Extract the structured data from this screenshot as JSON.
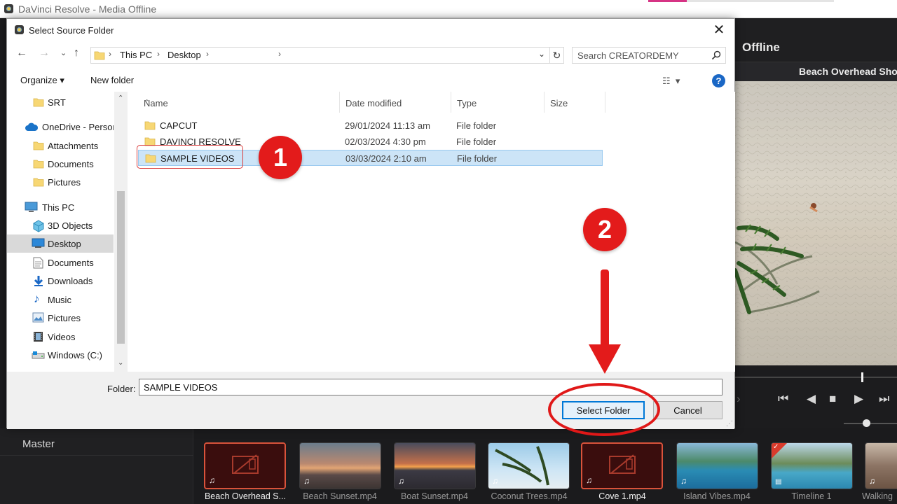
{
  "app": {
    "window_title": "DaVinci Resolve - Media Offline",
    "viewer_status": "Offline",
    "viewer_clip_name": "Beach Overhead Sho",
    "master_label": "Master",
    "clips": [
      {
        "name": "Beach Overhead S...",
        "offline": true,
        "active": true
      },
      {
        "name": "Beach Sunset.mp4",
        "offline": false,
        "active": false
      },
      {
        "name": "Boat Sunset.mp4",
        "offline": false,
        "active": false
      },
      {
        "name": "Coconut Trees.mp4",
        "offline": false,
        "active": false
      },
      {
        "name": "Cove 1.mp4",
        "offline": true,
        "active": true
      },
      {
        "name": "Island Vibes.mp4",
        "offline": false,
        "active": false
      },
      {
        "name": "Timeline 1",
        "offline": false,
        "active": false
      },
      {
        "name": "Walking",
        "offline": false,
        "active": false
      }
    ]
  },
  "dialog": {
    "title": "Select Source Folder",
    "address": {
      "crumbs": [
        "This PC",
        "Desktop"
      ]
    },
    "search_placeholder": "Search CREATORDEMY",
    "toolbar": {
      "organize": "Organize ▾",
      "new_folder": "New folder"
    },
    "nav_items": [
      {
        "label": "SRT",
        "icon": "folder-icon"
      },
      {
        "label": "OneDrive - Person",
        "icon": "cloud-icon"
      },
      {
        "label": "Attachments",
        "icon": "folder-icon"
      },
      {
        "label": "Documents",
        "icon": "folder-icon"
      },
      {
        "label": "Pictures",
        "icon": "folder-icon"
      },
      {
        "label": "This PC",
        "icon": "computer-icon"
      },
      {
        "label": "3D Objects",
        "icon": "cube-icon"
      },
      {
        "label": "Desktop",
        "icon": "desktop-icon",
        "selected": true
      },
      {
        "label": "Documents",
        "icon": "document-icon"
      },
      {
        "label": "Downloads",
        "icon": "download-icon"
      },
      {
        "label": "Music",
        "icon": "music-icon"
      },
      {
        "label": "Pictures",
        "icon": "picture-icon"
      },
      {
        "label": "Videos",
        "icon": "film-icon"
      },
      {
        "label": "Windows (C:)",
        "icon": "drive-icon"
      }
    ],
    "columns": {
      "name": "Name",
      "date": "Date modified",
      "type": "Type",
      "size": "Size"
    },
    "files": [
      {
        "name": "CAPCUT",
        "date": "29/01/2024 11:13 am",
        "type": "File folder"
      },
      {
        "name": "DAVINCI RESOLVE",
        "date": "02/03/2024 4:30 pm",
        "type": "File folder"
      },
      {
        "name": "SAMPLE VIDEOS",
        "date": "03/03/2024 2:10 am",
        "type": "File folder",
        "selected": true
      }
    ],
    "folder_label": "Folder:",
    "folder_value": "SAMPLE VIDEOS",
    "select_button": "Select Folder",
    "cancel_button": "Cancel"
  },
  "annotations": {
    "step1": "1",
    "step2": "2",
    "accent_color": "#e31b1b"
  }
}
